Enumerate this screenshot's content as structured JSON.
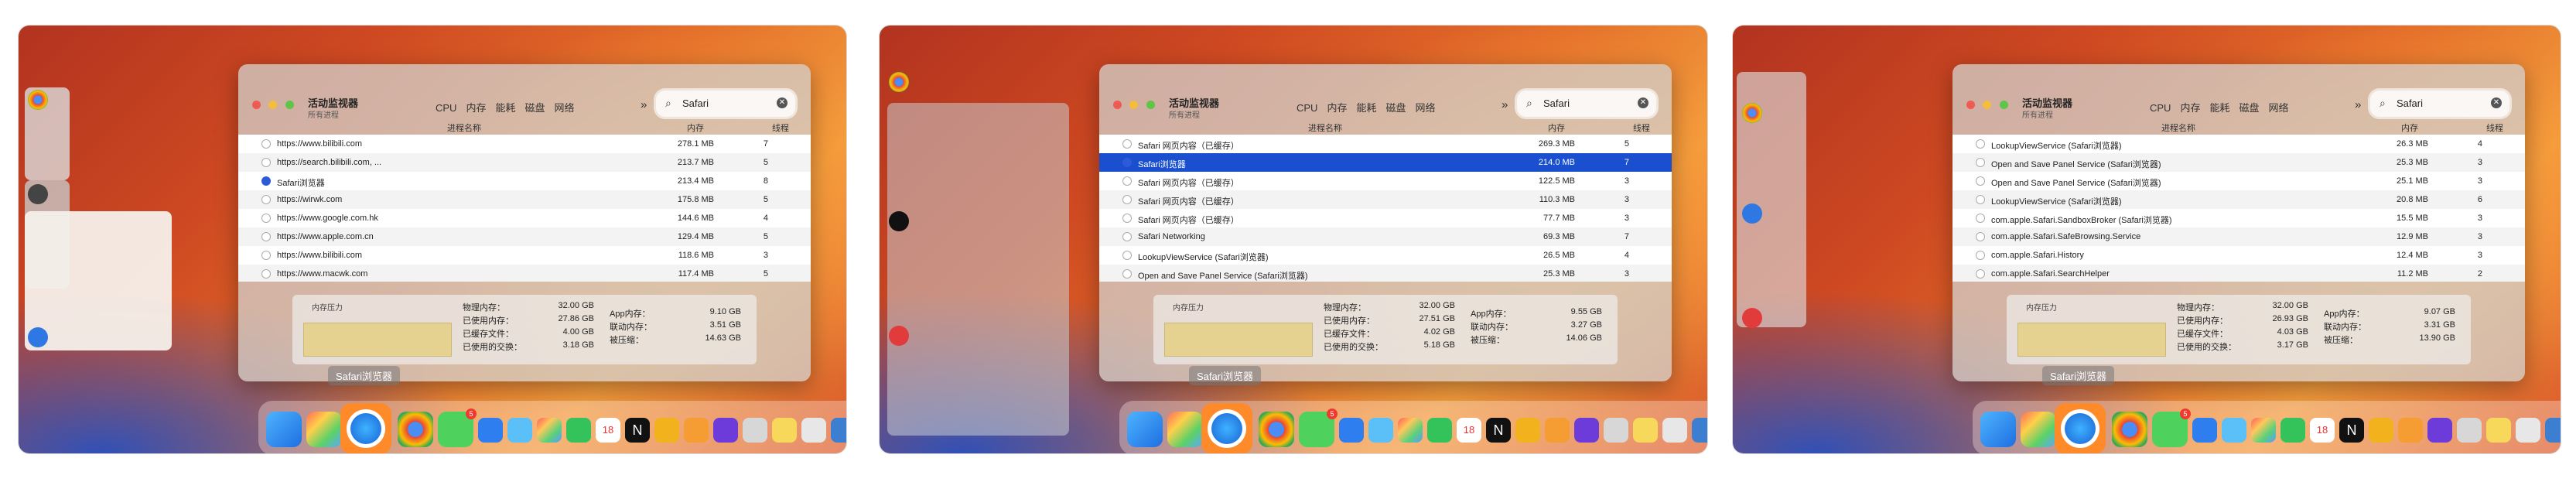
{
  "common": {
    "app_title": "活动监视器",
    "app_subtitle": "所有进程",
    "tabs": [
      "CPU",
      "内存",
      "能耗",
      "磁盘",
      "网络"
    ],
    "more": "»",
    "search_value": "Safari",
    "col_name": "进程名称",
    "col_mem": "内存",
    "col_threads": "线程",
    "pressure_title": "内存压力",
    "labels": {
      "physical": "物理内存：",
      "used": "已使用内存：",
      "cached": "已缓存文件：",
      "swap": "已使用的交换：",
      "app": "App内存：",
      "wired": "联动内存：",
      "compressed": "被压缩："
    },
    "dock_label": "Safari浏览器",
    "dock_badge": "5",
    "calendar_day": "18"
  },
  "panels": [
    {
      "rows": [
        {
          "name": "https://www.bilibili.com",
          "mem": "278.1 MB",
          "threads": "7"
        },
        {
          "name": "https://search.bilibili.com, ...",
          "mem": "213.7 MB",
          "threads": "5"
        },
        {
          "name": "Safari浏览器",
          "mem": "213.4 MB",
          "threads": "8",
          "icon": "safari"
        },
        {
          "name": "https://wirwk.com",
          "mem": "175.8 MB",
          "threads": "5"
        },
        {
          "name": "https://www.google.com.hk",
          "mem": "144.6 MB",
          "threads": "4"
        },
        {
          "name": "https://www.apple.com.cn",
          "mem": "129.4 MB",
          "threads": "5"
        },
        {
          "name": "https://www.bilibili.com",
          "mem": "118.6 MB",
          "threads": "3"
        },
        {
          "name": "https://www.macwk.com",
          "mem": "117.4 MB",
          "threads": "5"
        }
      ],
      "selected": -1,
      "stats": {
        "physical": "32.00 GB",
        "used": "27.86 GB",
        "cached": "4.00 GB",
        "swap": "3.18 GB",
        "app": "9.10 GB",
        "wired": "3.51 GB",
        "compressed": "14.63 GB"
      }
    },
    {
      "rows": [
        {
          "name": "Safari 网页内容（已缓存）",
          "mem": "269.3 MB",
          "threads": "5"
        },
        {
          "name": "Safari浏览器",
          "mem": "214.0 MB",
          "threads": "7",
          "icon": "safari"
        },
        {
          "name": "Safari 网页内容（已缓存）",
          "mem": "122.5 MB",
          "threads": "3"
        },
        {
          "name": "Safari 网页内容（已缓存）",
          "mem": "110.3 MB",
          "threads": "3"
        },
        {
          "name": "Safari 网页内容（已缓存）",
          "mem": "77.7 MB",
          "threads": "3"
        },
        {
          "name": "Safari Networking",
          "mem": "69.3 MB",
          "threads": "7"
        },
        {
          "name": "LookupViewService (Safari浏览器)",
          "mem": "26.5 MB",
          "threads": "4"
        },
        {
          "name": "Open and Save Panel Service (Safari浏览器)",
          "mem": "25.3 MB",
          "threads": "3"
        }
      ],
      "selected": 1,
      "stats": {
        "physical": "32.00 GB",
        "used": "27.51 GB",
        "cached": "4.02 GB",
        "swap": "5.18 GB",
        "app": "9.55 GB",
        "wired": "3.27 GB",
        "compressed": "14.06 GB"
      }
    },
    {
      "rows": [
        {
          "name": "LookupViewService (Safari浏览器)",
          "mem": "26.3 MB",
          "threads": "4"
        },
        {
          "name": "Open and Save Panel Service (Safari浏览器)",
          "mem": "25.3 MB",
          "threads": "3"
        },
        {
          "name": "Open and Save Panel Service (Safari浏览器)",
          "mem": "25.1 MB",
          "threads": "3"
        },
        {
          "name": "LookupViewService (Safari浏览器)",
          "mem": "20.8 MB",
          "threads": "6"
        },
        {
          "name": "com.apple.Safari.SandboxBroker (Safari浏览器)",
          "mem": "15.5 MB",
          "threads": "3"
        },
        {
          "name": "com.apple.Safari.SafeBrowsing.Service",
          "mem": "12.9 MB",
          "threads": "3"
        },
        {
          "name": "com.apple.Safari.History",
          "mem": "12.4 MB",
          "threads": "3"
        },
        {
          "name": "com.apple.Safari.SearchHelper",
          "mem": "11.2 MB",
          "threads": "2"
        }
      ],
      "selected": -1,
      "stats": {
        "physical": "32.00 GB",
        "used": "26.93 GB",
        "cached": "4.03 GB",
        "swap": "3.17 GB",
        "app": "9.07 GB",
        "wired": "3.31 GB",
        "compressed": "13.90 GB"
      }
    }
  ],
  "colors": {
    "selection": "#1a4fcf",
    "accent": "#ff8a2a",
    "pressure": "#e6d290"
  }
}
